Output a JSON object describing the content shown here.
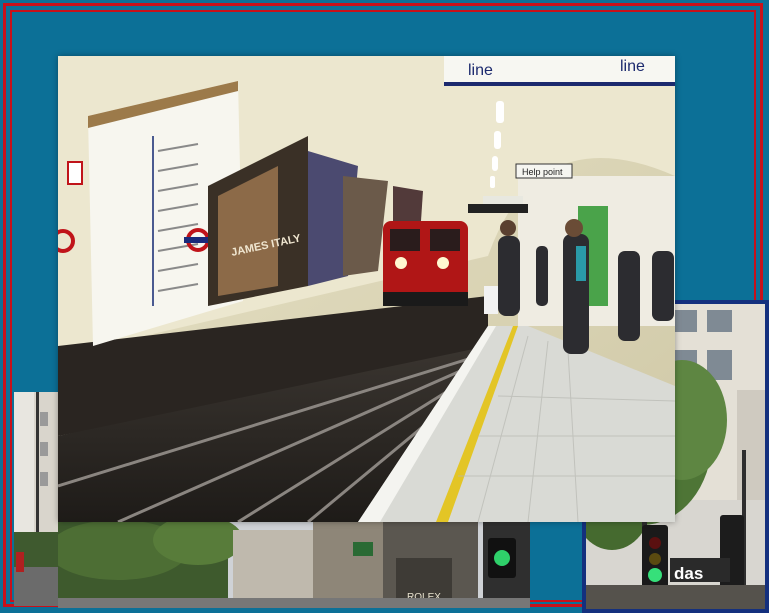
{
  "photos": {
    "tube_platform": {
      "sign_left_text": "line",
      "sign_right_text": "line",
      "help_point_text": "Help point",
      "poster_text": "JAMES ITALY"
    },
    "street_bottom": {
      "shop_sign_text": "ROLEX"
    },
    "street_right": {
      "shop_sign_text": "das"
    }
  },
  "colors": {
    "background": "#0c7097",
    "frame_red": "#c8111a",
    "frame_blue": "#14307e"
  }
}
